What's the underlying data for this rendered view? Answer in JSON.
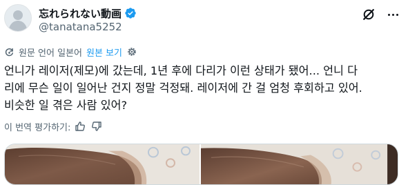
{
  "user": {
    "display_name": "忘れられない動画",
    "handle": "@tanatana5252",
    "verified": true,
    "avatar": "default-avatar-silhouette"
  },
  "header_actions": {
    "grok_icon": "grok-slash-icon",
    "more_icon": "more-dots-icon"
  },
  "translation": {
    "label": "원문 언어 일본어",
    "show_original_link": "원본 보기",
    "translate_icon": "translate-icon",
    "settings_icon": "gear-icon"
  },
  "tweet": {
    "lines": [
      "언니가 레이저(제모)에 갔는데, 1년 후에 다리가 이런 상태가 됐어... 언니 다",
      "리에 무슨 일이 일어난 건지 정말 걱정돼. 레이저에 간 걸 엄청 후회하고 있어.",
      "비슷한 일 겪은 사람 있어?"
    ]
  },
  "rate_translation": {
    "label": "이 번역 평가하기:",
    "thumbs_up_icon": "thumbs-up-icon",
    "thumbs_down_icon": "thumbs-down-icon"
  },
  "media": {
    "count": 2,
    "colors": {
      "skin_dark": "#6b4a3a",
      "skin_mid": "#8a6450",
      "fabric": "#e9e4dd"
    }
  },
  "colors": {
    "text_primary": "#0f1419",
    "text_secondary": "#536471",
    "accent": "#1d9bf0",
    "border": "#cfd9de"
  }
}
